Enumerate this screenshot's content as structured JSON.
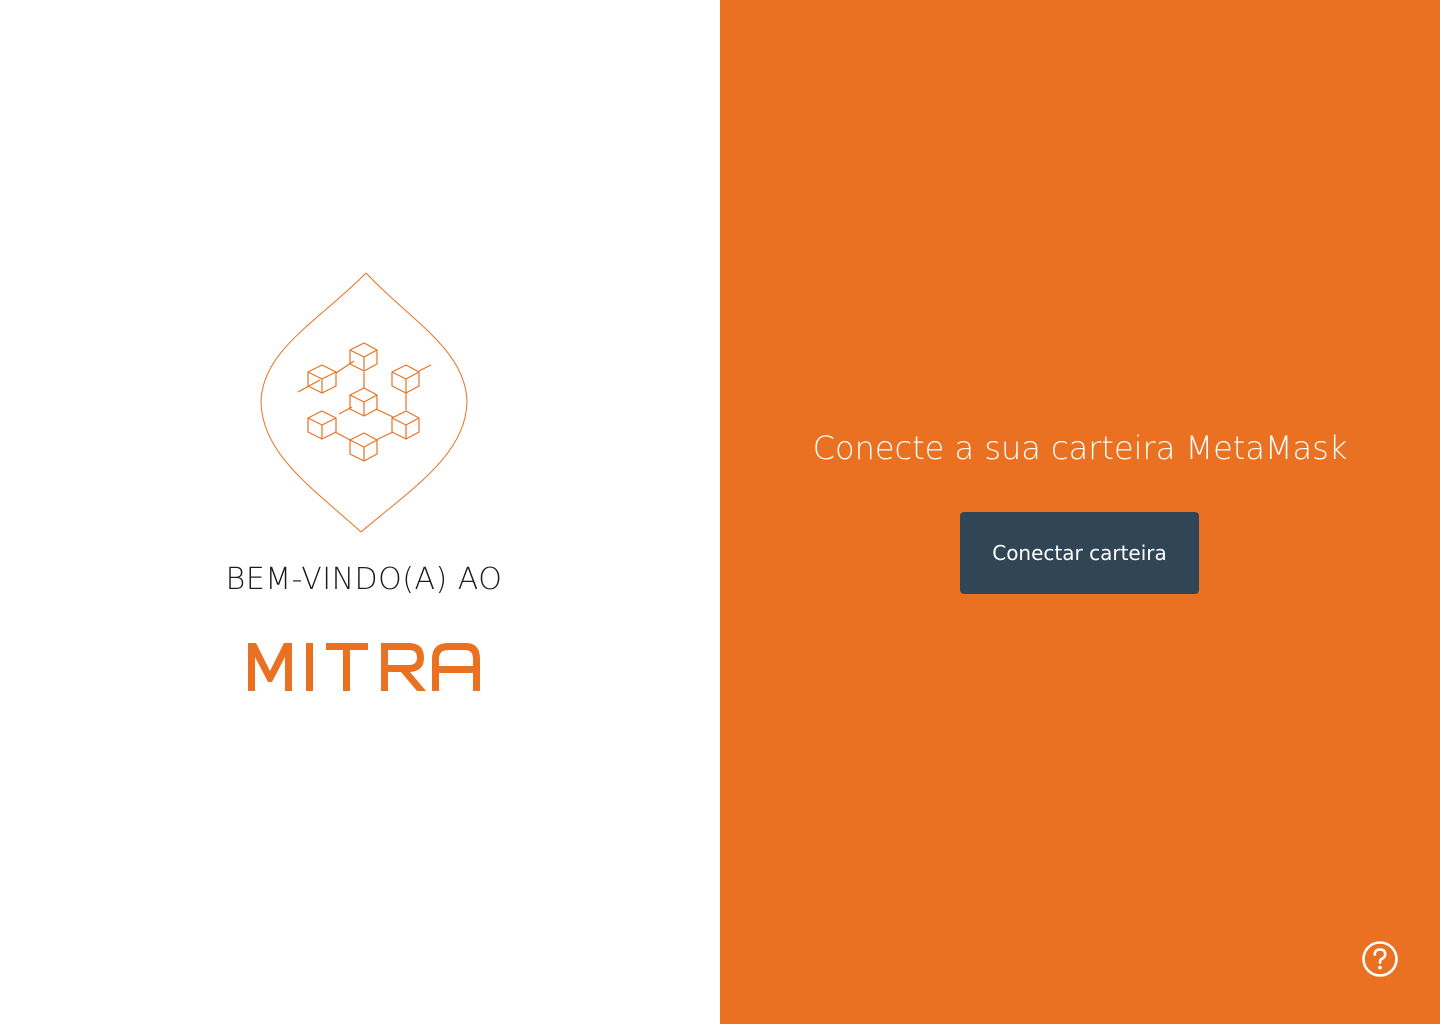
{
  "left": {
    "emblem_icon": "blockchain-cubes-icon",
    "welcome_text": "BEM-VINDO(A) AO",
    "brand_name": "MITRA"
  },
  "right": {
    "heading": "Conecte a sua carteira MetaMask",
    "connect_button_label": "Conectar carteira",
    "help_icon": "question-circle-icon"
  },
  "colors": {
    "brand_orange": "#ea7121",
    "button_navy": "#304657",
    "background_white": "#ffffff"
  }
}
